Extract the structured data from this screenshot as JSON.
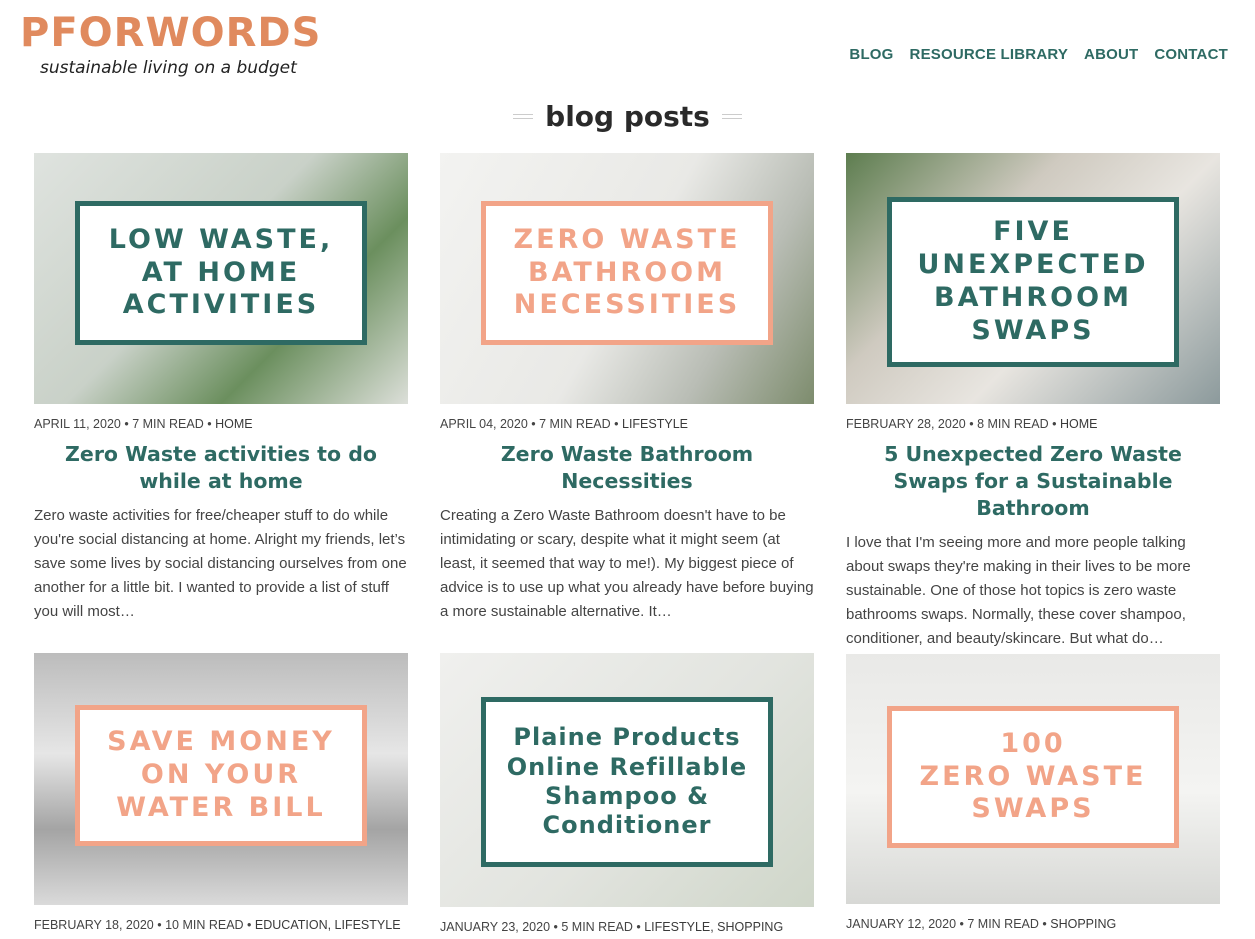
{
  "colors": {
    "brand": "#E08A5E",
    "accent": "#2E6A63",
    "peach": "#F2A488"
  },
  "header": {
    "logo_title": "PFORWORDS",
    "logo_tagline": "sustainable living on a budget",
    "nav": [
      "BLOG",
      "RESOURCE LIBRARY",
      "ABOUT",
      "CONTACT"
    ]
  },
  "section_title": "blog posts",
  "posts": [
    {
      "image_text": "LOW WASTE,\nAT HOME\nACTIVITIES",
      "date": "APRIL 11, 2020",
      "read_time": "7 MIN READ",
      "categories": "HOME",
      "title": "Zero Waste activities to do while at home",
      "excerpt": "Zero waste activities for free/cheaper stuff to do while you're social distancing at home. Alright my friends, let’s save some lives by social distancing ourselves from one another for a little bit. I wanted to provide a list of stuff you will most…"
    },
    {
      "image_text": "ZERO WASTE\nBATHROOM\nNECESSITIES",
      "date": "APRIL 04, 2020",
      "read_time": "7 MIN READ",
      "categories": "LIFESTYLE",
      "title": "Zero Waste Bathroom Necessities",
      "excerpt": "Creating a Zero Waste Bathroom doesn't have to be intimidating or scary, despite what it might seem (at least, it seemed that way to me!). My biggest piece of advice is to use up what you already have before buying a more sustainable alternative. It…"
    },
    {
      "image_text": "FIVE\nUNEXPECTED\nBATHROOM\nSWAPS",
      "date": "FEBRUARY 28, 2020",
      "read_time": "8 MIN READ",
      "categories": "HOME",
      "title": "5 Unexpected Zero Waste Swaps for a Sustainable Bathroom",
      "excerpt": "I love that I'm seeing more and more people talking about swaps they're making in their lives to be more sustainable. One of those hot topics is zero waste bathrooms swaps. Normally, these cover shampoo, conditioner, and beauty/skincare. But what do…"
    },
    {
      "image_text": "SAVE MONEY\nON YOUR\nWATER BILL",
      "date": "FEBRUARY 18, 2020",
      "read_time": "10 MIN READ",
      "categories": "EDUCATION, LIFESTYLE",
      "title": "",
      "excerpt": ""
    },
    {
      "image_text": "Plaine Products\nOnline Refillable\nShampoo &\nConditioner",
      "date": "JANUARY 23, 2020",
      "read_time": "5 MIN READ",
      "categories": "LIFESTYLE, SHOPPING",
      "title": "",
      "excerpt": ""
    },
    {
      "image_text": "100\nZERO WASTE\nSWAPS",
      "date": "JANUARY 12, 2020",
      "read_time": "7 MIN READ",
      "categories": "SHOPPING",
      "title": "",
      "excerpt": ""
    }
  ]
}
